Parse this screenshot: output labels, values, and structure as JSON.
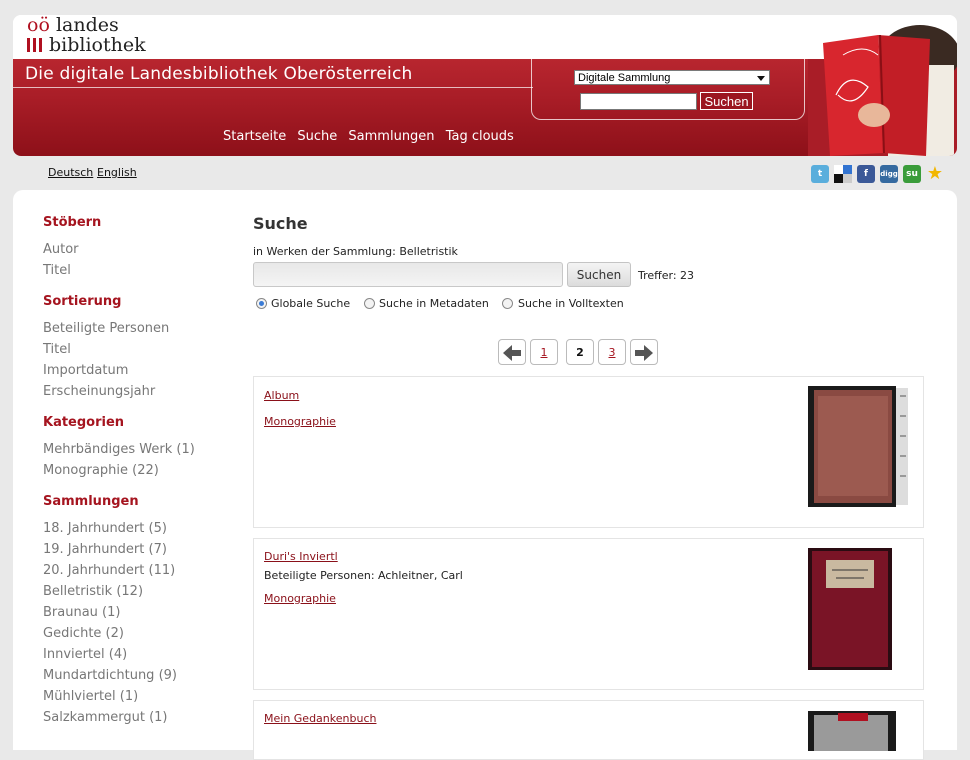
{
  "header": {
    "logo_line1_prefix": "oö",
    "logo_line1": "landes",
    "logo_line2": "bibliothek",
    "site_title": "Die digitale Landesbibliothek Oberösterreich",
    "collection_select": "Digitale Sammlung",
    "search_button": "Suchen",
    "nav": [
      "Startseite",
      "Suche",
      "Sammlungen",
      "Tag clouds"
    ]
  },
  "lang": {
    "de": "Deutsch",
    "en": "English"
  },
  "social": [
    "twitter-icon",
    "delicious-icon",
    "facebook-icon",
    "digg-icon",
    "stumbleupon-icon",
    "favorite-star-icon"
  ],
  "sidebar": {
    "stoebern": {
      "title": "Stöbern",
      "items": [
        "Autor",
        "Titel"
      ]
    },
    "sortierung": {
      "title": "Sortierung",
      "items": [
        "Beteiligte Personen",
        "Titel",
        "Importdatum",
        "Erscheinungsjahr"
      ]
    },
    "kategorien": {
      "title": "Kategorien",
      "items": [
        "Mehrbändiges Werk (1)",
        "Monographie (22)"
      ]
    },
    "sammlungen": {
      "title": "Sammlungen",
      "items": [
        "18. Jahrhundert (5)",
        "19. Jahrhundert (7)",
        "20. Jahrhundert (11)",
        "Belletristik (12)",
        "Braunau (1)",
        "Gedichte (2)",
        "Innviertel (4)",
        "Mundartdichtung (9)",
        "Mühlviertel (1)",
        "Salzkammergut (1)"
      ]
    }
  },
  "content": {
    "title": "Suche",
    "scope": "in Werken der Sammlung: Belletristik",
    "search_button": "Suchen",
    "hits": "Treffer: 23",
    "radios": [
      "Globale Suche",
      "Suche in Metadaten",
      "Suche in Volltexten"
    ],
    "pages": [
      "1",
      "2",
      "3"
    ],
    "results": [
      {
        "title": "Album",
        "persons": "",
        "type": "Monographie"
      },
      {
        "title": "Duri's Inviertl",
        "persons": "Beteiligte Personen: Achleitner, Carl",
        "type": "Monographie"
      },
      {
        "title": "Mein Gedankenbuch",
        "persons": "",
        "type": ""
      }
    ]
  }
}
